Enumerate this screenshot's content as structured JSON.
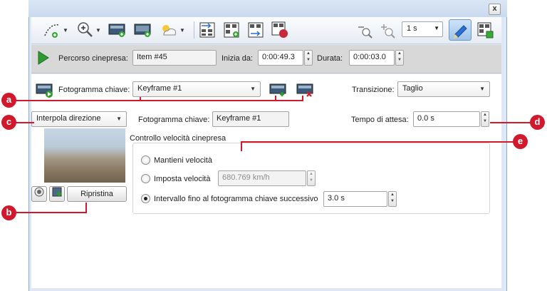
{
  "window": {
    "close_glyph": "x"
  },
  "toolbar": {
    "zoom_value": "1 s",
    "icons": [
      "path-add-icon",
      "zoom-in-icon",
      "add-keyframe-icon",
      "add-frame-icon",
      "weather-icon",
      "import-icon",
      "frame-grid-icon",
      "export-icon",
      "record-icon",
      "zoom-out-icon",
      "zoom-in-small-icon",
      "edit-icon",
      "frames-icon"
    ]
  },
  "pathbar": {
    "path_label": "Percorso cinepresa:",
    "path_value": "Item #45",
    "start_label": "Inizia da:",
    "start_value": "0:00:49.3",
    "duration_label": "Durata:",
    "duration_value": "0:00:03.0"
  },
  "keyframe": {
    "label": "Fotogramma chiave:",
    "selected": "Keyframe #1",
    "transition_label": "Transizione:",
    "transition_value": "Taglio"
  },
  "row2": {
    "interpolate_value": "Interpola direzione",
    "keyframe_label": "Fotogramma chiave:",
    "keyframe_value": "Keyframe #1",
    "wait_label": "Tempo di attesa:",
    "wait_value": "0.0 s"
  },
  "speed": {
    "group_title": "Controllo velocità cinepresa",
    "keep_label": "Mantieni velocità",
    "set_label": "Imposta velocità",
    "set_value": "680.769 km/h",
    "interval_label": "Intervallo fino al fotogramma chiave successivo",
    "interval_value": "3.0 s"
  },
  "reset_label": "Ripristina",
  "callouts": {
    "a": "a",
    "b": "b",
    "c": "c",
    "d": "d",
    "e": "e"
  },
  "colors": {
    "callout": "#d0192c",
    "play": "#2f9a2f"
  }
}
